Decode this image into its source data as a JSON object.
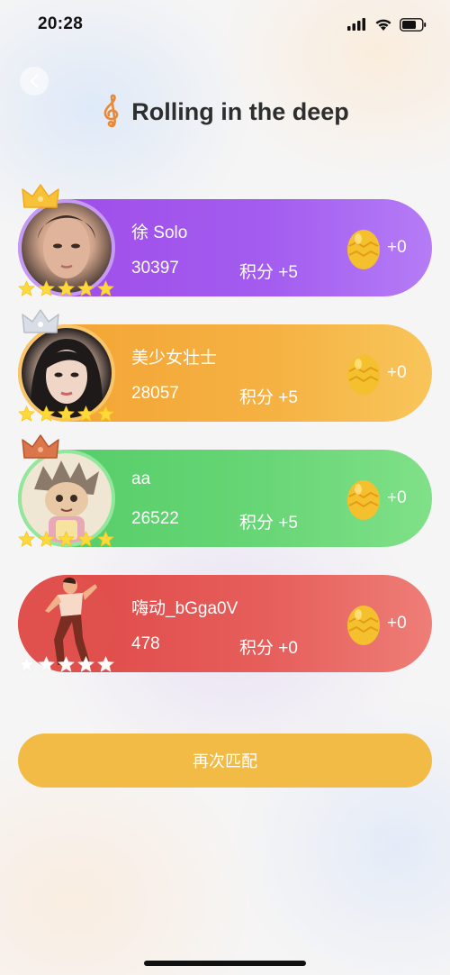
{
  "status_bar": {
    "time": "20:28",
    "icons": [
      "signal-icon",
      "wifi-icon",
      "battery-icon"
    ]
  },
  "header": {
    "back_icon": "chevron-left-icon",
    "music_icon": "treble-clef-icon",
    "title": "Rolling in the deep"
  },
  "players": [
    {
      "rank_icon": "gold-crown-icon",
      "name": "徐 Solo",
      "score": "30397",
      "points": "积分 +5",
      "coins": "+0",
      "stars_filled": 5,
      "stars_total": 5,
      "accent": "#a35cef"
    },
    {
      "rank_icon": "silver-crown-icon",
      "name": "美少女壮士",
      "score": "28057",
      "points": "积分 +5",
      "coins": "+0",
      "stars_filled": 5,
      "stars_total": 5,
      "accent": "#f5b142"
    },
    {
      "rank_icon": "bronze-crown-icon",
      "name": "aa",
      "score": "26522",
      "points": "积分 +5",
      "coins": "+0",
      "stars_filled": 5,
      "stars_total": 5,
      "accent": "#68d676"
    },
    {
      "rank_icon": "",
      "name": "嗨动_bGga0V",
      "score": "478",
      "points": "积分 +0",
      "coins": "+0",
      "stars_filled": 0,
      "stars_total": 5,
      "accent": "#e65e5b"
    }
  ],
  "actions": {
    "rematch_label": "再次匹配"
  },
  "colors": {
    "gold_star": "#ffd93b",
    "egg": "#f4c02d",
    "button": "#f2bb46"
  }
}
